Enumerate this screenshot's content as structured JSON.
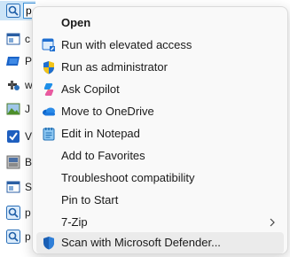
{
  "files": [
    {
      "icon": "search-file-icon",
      "label": "p"
    },
    {
      "icon": "window-file-icon",
      "label": "c"
    },
    {
      "icon": "shortcut-file-icon",
      "label": "P"
    },
    {
      "icon": "tools-file-icon",
      "label": "w"
    },
    {
      "icon": "image-file-icon",
      "label": "J"
    },
    {
      "icon": "checkbox-file-icon",
      "label": "V"
    },
    {
      "icon": "archive-file-icon",
      "label": "B"
    },
    {
      "icon": "window-file-icon",
      "label": "S"
    },
    {
      "icon": "search-file-icon",
      "label": "p"
    },
    {
      "icon": "search-file-icon",
      "label": "p"
    }
  ],
  "menu": {
    "items": [
      {
        "label": "Open",
        "icon": ""
      },
      {
        "label": "Run with elevated access",
        "icon": "elevated-access-icon"
      },
      {
        "label": "Run as administrator",
        "icon": "uac-shield-icon"
      },
      {
        "label": "Ask Copilot",
        "icon": "copilot-icon"
      },
      {
        "label": "Move to OneDrive",
        "icon": "onedrive-cloud-icon"
      },
      {
        "label": "Edit in Notepad",
        "icon": "notepad-icon"
      },
      {
        "label": "Add to Favorites",
        "icon": ""
      },
      {
        "label": "Troubleshoot compatibility",
        "icon": ""
      },
      {
        "label": "Pin to Start",
        "icon": ""
      },
      {
        "label": "7-Zip",
        "icon": "",
        "submenu": "chevron-right-icon"
      },
      {
        "label": "Scan with Microsoft Defender...",
        "icon": "defender-shield-icon"
      }
    ]
  },
  "colors": {
    "menu_bg": "#f9f9f9",
    "hover_bg": "#ebebeb",
    "selection_bg": "#cce4f7",
    "accent": "#0067c0"
  }
}
